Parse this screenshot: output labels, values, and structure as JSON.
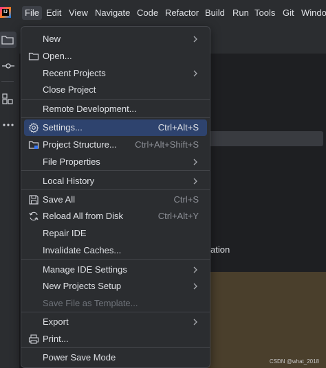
{
  "menubar": {
    "items": [
      "File",
      "Edit",
      "View",
      "Navigate",
      "Code",
      "Refactor",
      "Build",
      "Run",
      "Tools",
      "Git",
      "Windo"
    ],
    "active": "File"
  },
  "file_menu": {
    "items": [
      {
        "label": "New",
        "shortcut": "",
        "submenu": true,
        "icon": ""
      },
      {
        "label": "Open...",
        "shortcut": "",
        "submenu": false,
        "icon": "folder-icon"
      },
      {
        "label": "Recent Projects",
        "shortcut": "",
        "submenu": true,
        "icon": ""
      },
      {
        "label": "Close Project",
        "shortcut": "",
        "submenu": false,
        "icon": ""
      },
      {
        "label": "Remote Development...",
        "shortcut": "",
        "submenu": false,
        "icon": ""
      },
      {
        "label": "Settings...",
        "shortcut": "Ctrl+Alt+S",
        "submenu": false,
        "icon": "gear-icon",
        "selected": true
      },
      {
        "label": "Project Structure...",
        "shortcut": "Ctrl+Alt+Shift+S",
        "submenu": false,
        "icon": "project-structure-icon"
      },
      {
        "label": "File Properties",
        "shortcut": "",
        "submenu": true,
        "icon": ""
      },
      {
        "label": "Local History",
        "shortcut": "",
        "submenu": true,
        "icon": ""
      },
      {
        "label": "Save All",
        "shortcut": "Ctrl+S",
        "submenu": false,
        "icon": "save-icon"
      },
      {
        "label": "Reload All from Disk",
        "shortcut": "Ctrl+Alt+Y",
        "submenu": false,
        "icon": "reload-icon"
      },
      {
        "label": "Repair IDE",
        "shortcut": "",
        "submenu": false,
        "icon": ""
      },
      {
        "label": "Invalidate Caches...",
        "shortcut": "",
        "submenu": false,
        "icon": ""
      },
      {
        "label": "Manage IDE Settings",
        "shortcut": "",
        "submenu": true,
        "icon": ""
      },
      {
        "label": "New Projects Setup",
        "shortcut": "",
        "submenu": true,
        "icon": ""
      },
      {
        "label": "Save File as Template...",
        "shortcut": "",
        "submenu": false,
        "icon": "",
        "disabled": true
      },
      {
        "label": "Export",
        "shortcut": "",
        "submenu": true,
        "icon": ""
      },
      {
        "label": "Print...",
        "shortcut": "",
        "submenu": false,
        "icon": "printer-icon"
      },
      {
        "label": "Power Save Mode",
        "shortcut": "",
        "submenu": false,
        "icon": ""
      }
    ]
  },
  "background": {
    "partial_text": "ation"
  },
  "watermark": "CSDN @what_2018",
  "colors": {
    "menu_bg": "#2b2d30",
    "selection": "#2e436e",
    "text": "#dfe1e5",
    "shortcut": "#8c8f96",
    "disabled": "#6f737a"
  }
}
